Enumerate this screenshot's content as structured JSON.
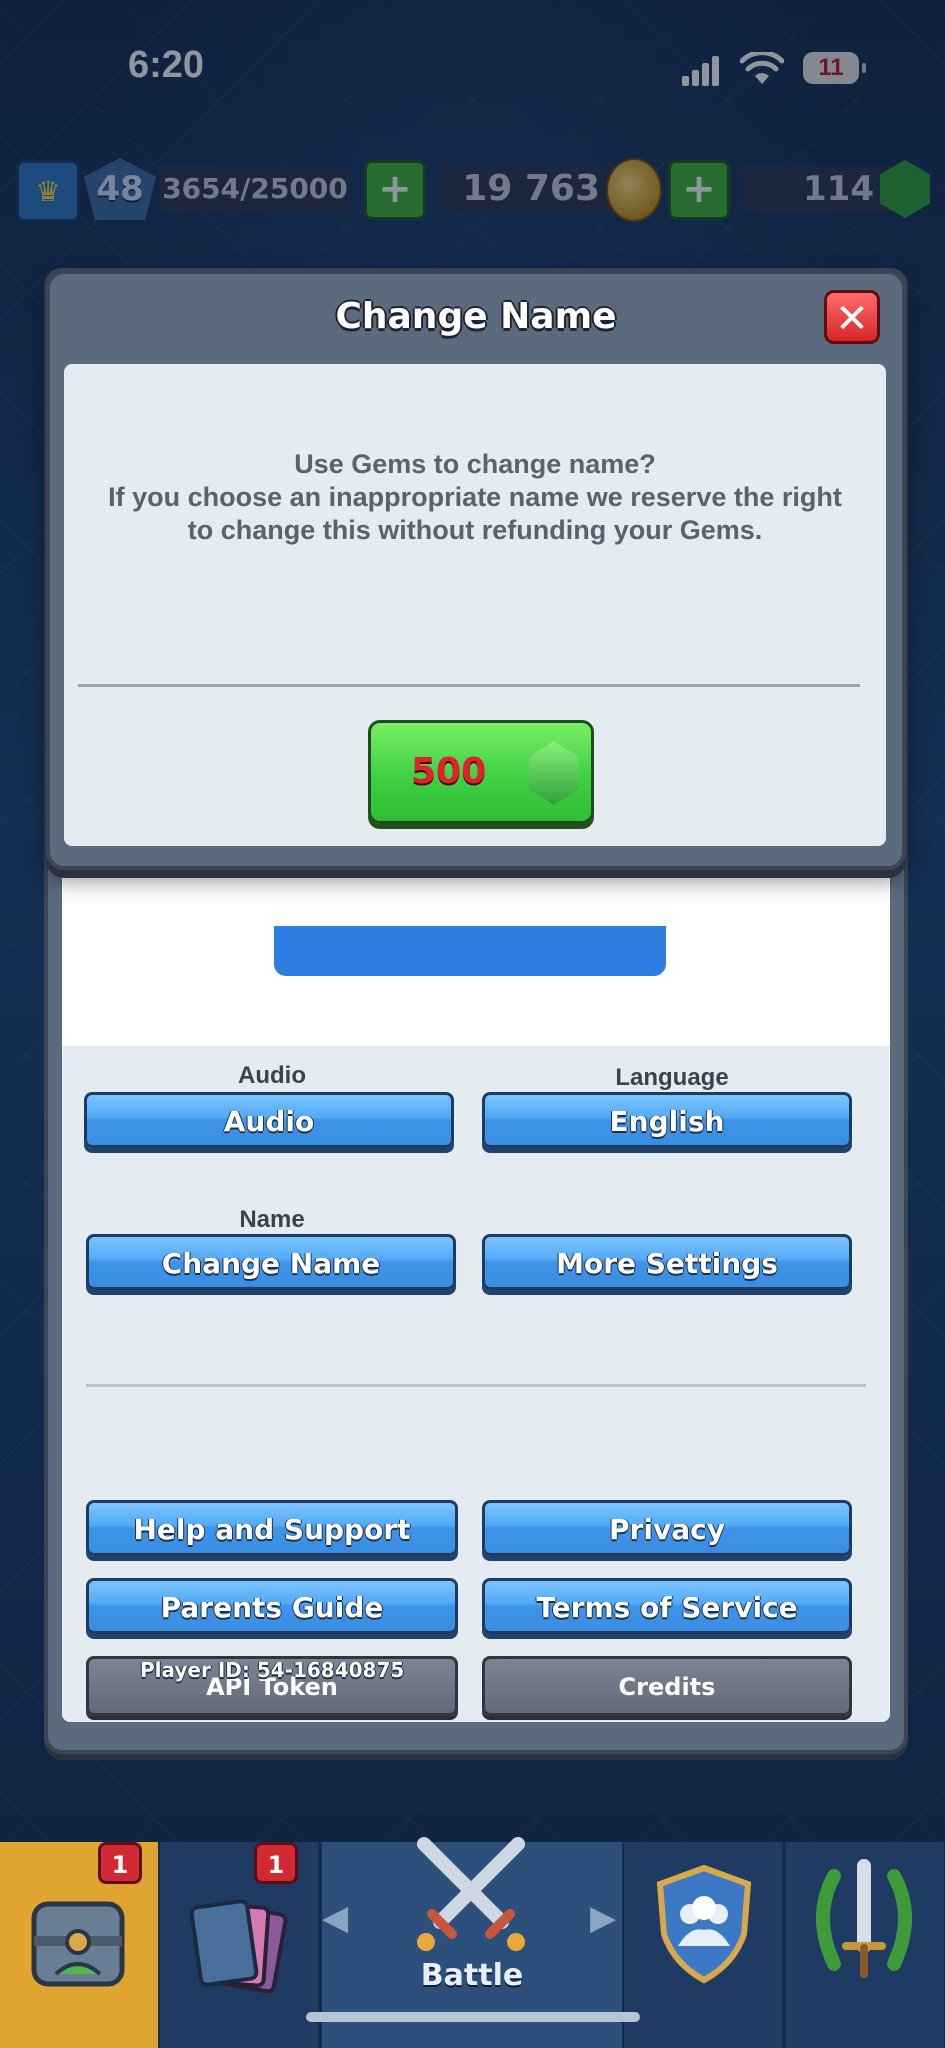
{
  "status_bar": {
    "time": "6:20",
    "battery": "11"
  },
  "resources": {
    "level": "48",
    "xp": "3654/25000",
    "gold": "19 763",
    "gems": "114"
  },
  "settings": {
    "audio_label": "Audio",
    "audio_button": "Audio",
    "language_label": "Language",
    "language_button": "English",
    "name_label": "Name",
    "change_name_button": "Change Name",
    "more_settings_button": "More Settings",
    "help_button": "Help and Support",
    "privacy_button": "Privacy",
    "parents_button": "Parents Guide",
    "terms_button": "Terms of Service",
    "api_button": "API Token",
    "credits_button": "Credits",
    "player_id": "Player ID: 54-16840875"
  },
  "modal": {
    "title": "Change Name",
    "close": "✕",
    "line1": "Use Gems to change name?",
    "line2": "If you choose an inappropriate name we reserve the right to change this without refunding your Gems.",
    "price": "500"
  },
  "bottom_nav": {
    "shop_badge": "1",
    "cards_badge": "1",
    "battle_label": "Battle"
  },
  "colors": {
    "button_blue": "#52aaf5",
    "button_green": "#3fd043",
    "close_red": "#d8262b",
    "price_red": "#e2202a"
  }
}
